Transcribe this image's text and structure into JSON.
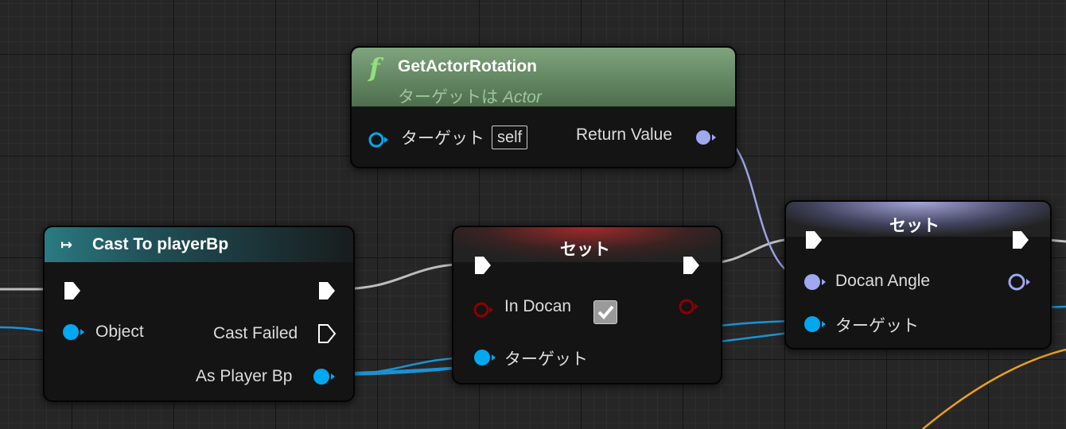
{
  "nodes": {
    "get_actor_rotation": {
      "title": "GetActorRotation",
      "subtitle_prefix": "ターゲットは",
      "subtitle_class": "Actor",
      "function_glyph": "f",
      "pins": {
        "target": "ターゲット",
        "target_default": "self",
        "return_value": "Return Value"
      }
    },
    "cast_to_player": {
      "title": "Cast To playerBp",
      "cast_glyph": "↦",
      "pins": {
        "object": "Object",
        "cast_failed": "Cast Failed",
        "as_player": "As Player Bp"
      }
    },
    "set_in_docan": {
      "title": "セット",
      "pins": {
        "in_docan": "In Docan",
        "in_docan_checked": true,
        "target": "ターゲット"
      }
    },
    "set_docan_angle": {
      "title": "セット",
      "pins": {
        "docan_angle": "Docan Angle",
        "target": "ターゲット"
      }
    }
  },
  "colors": {
    "exec_wire": "#c8c8c8",
    "object_pin": "#00a8f0",
    "rotator_pin": "#a0a8f0",
    "bool_pin": "#8c0000",
    "float_wire": "#f0b020"
  }
}
